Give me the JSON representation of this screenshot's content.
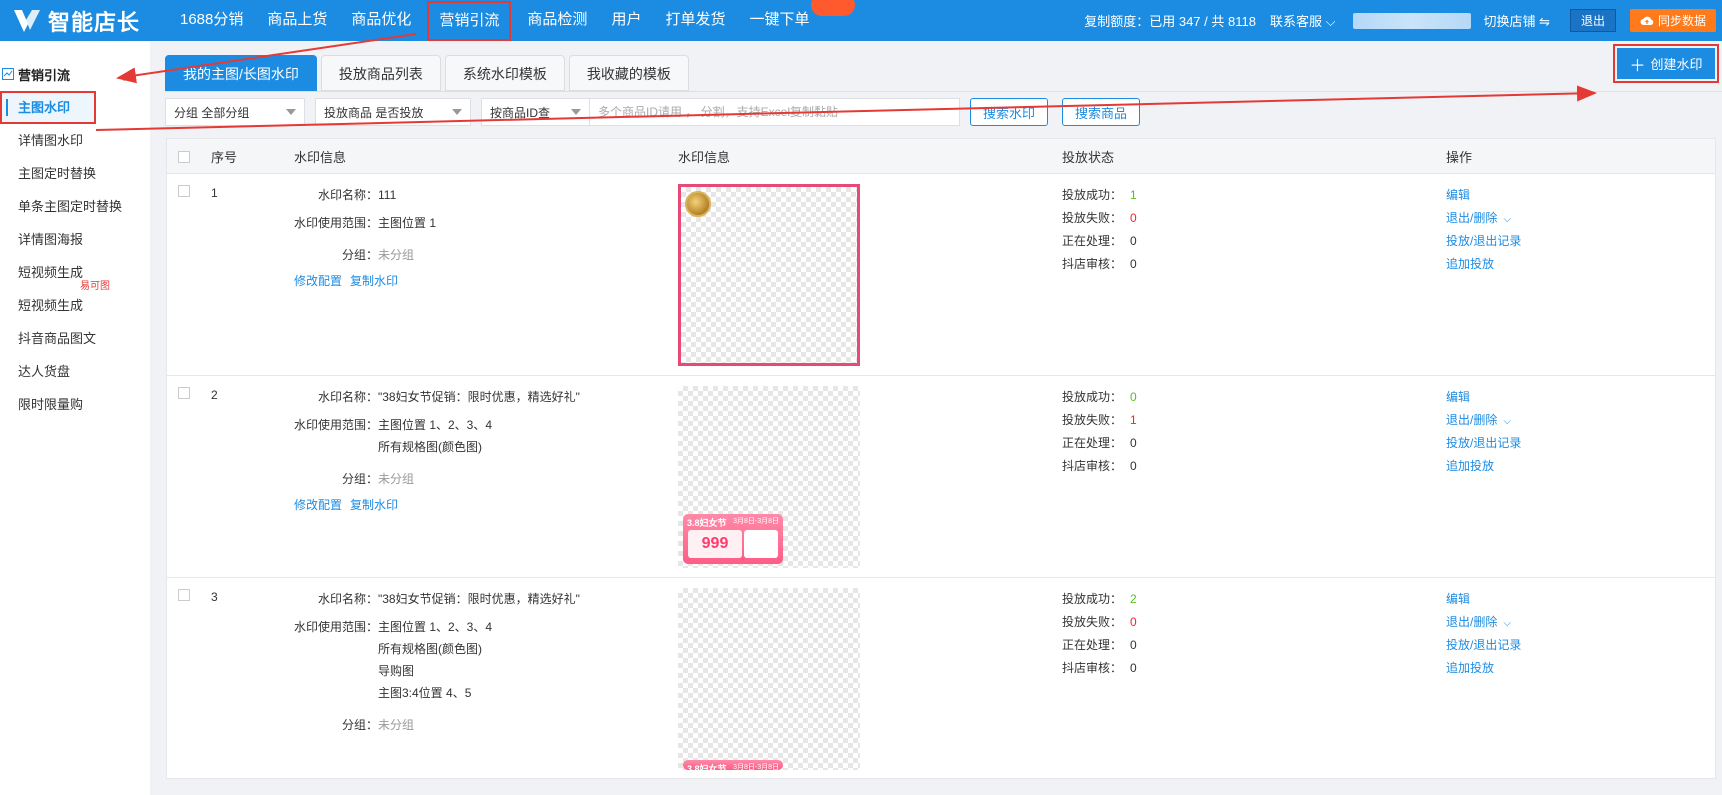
{
  "app": {
    "name": "智能店长"
  },
  "nav": {
    "items": [
      "1688分销",
      "商品上货",
      "商品优化",
      "营销引流",
      "商品检测",
      "用户",
      "打单发货",
      "一键下单"
    ],
    "quota": "复制额度：已用 347 / 共 8118",
    "service": "联系客服",
    "switch_shop": "切换店铺 ⇋",
    "exit": "退出",
    "sync": "同步数据"
  },
  "sidebar": {
    "header": "营销引流",
    "items": [
      "主图水印",
      "详情图水印",
      "主图定时替换",
      "单条主图定时替换",
      "详情图海报",
      "短视频生成",
      "短视频生成",
      "抖音商品图文",
      "达人货盘",
      "限时限量购"
    ],
    "tag": "易可图"
  },
  "tabs": [
    "我的主图/长图水印",
    "投放商品列表",
    "系统水印模板",
    "我收藏的模板"
  ],
  "create_button": "创建水印",
  "filters": {
    "group_label": "分组",
    "group_value": "全部分组",
    "put_label": "投放商品",
    "put_value": "是否投放",
    "id_value": "按商品ID查",
    "search_placeholder": "多个商品ID请用 ， 分割，支持Excel复制黏贴",
    "search_watermark": "搜索水印",
    "search_goods": "搜索商品"
  },
  "table": {
    "headers": [
      "序号",
      "水印信息",
      "水印信息",
      "投放状态",
      "操作"
    ],
    "labels": {
      "name": "水印名称：",
      "scope": "水印使用范围：",
      "group": "分组：",
      "edit_config": "修改配置",
      "copy": "复制水印",
      "success": "投放成功：",
      "fail": "投放失败：",
      "processing": "正在处理：",
      "review": "抖店审核："
    },
    "actions": [
      "编辑",
      "退出/删除",
      "投放/退出记录",
      "追加投放"
    ],
    "rows": [
      {
        "index": "1",
        "name": "111",
        "scope": [
          "主图位置 1"
        ],
        "group": "未分组",
        "success": "1",
        "fail": "0",
        "processing": "0",
        "review": "0"
      },
      {
        "index": "2",
        "name": "\"38妇女节促销：限时优惠，精选好礼\"",
        "scope": [
          "主图位置 1、2、3、4",
          "所有规格图(颜色图)"
        ],
        "group": "未分组",
        "success": "0",
        "fail": "1",
        "processing": "0",
        "review": "0"
      },
      {
        "index": "3",
        "name": "\"38妇女节促销：限时优惠，精选好礼\"",
        "scope": [
          "主图位置 1、2、3、4",
          "所有规格图(颜色图)",
          "导购图",
          "主图3:4位置 4、5"
        ],
        "group": "未分组",
        "success": "2",
        "fail": "0",
        "processing": "0",
        "review": "0"
      }
    ],
    "promo": {
      "title": "3.8妇女节",
      "date": "3月8日-3月8日",
      "price": "999"
    }
  },
  "colors": {
    "brand": "#1c8ce3",
    "annotation": "#e53935",
    "success": "#52c41a",
    "fail": "#f5222d"
  }
}
